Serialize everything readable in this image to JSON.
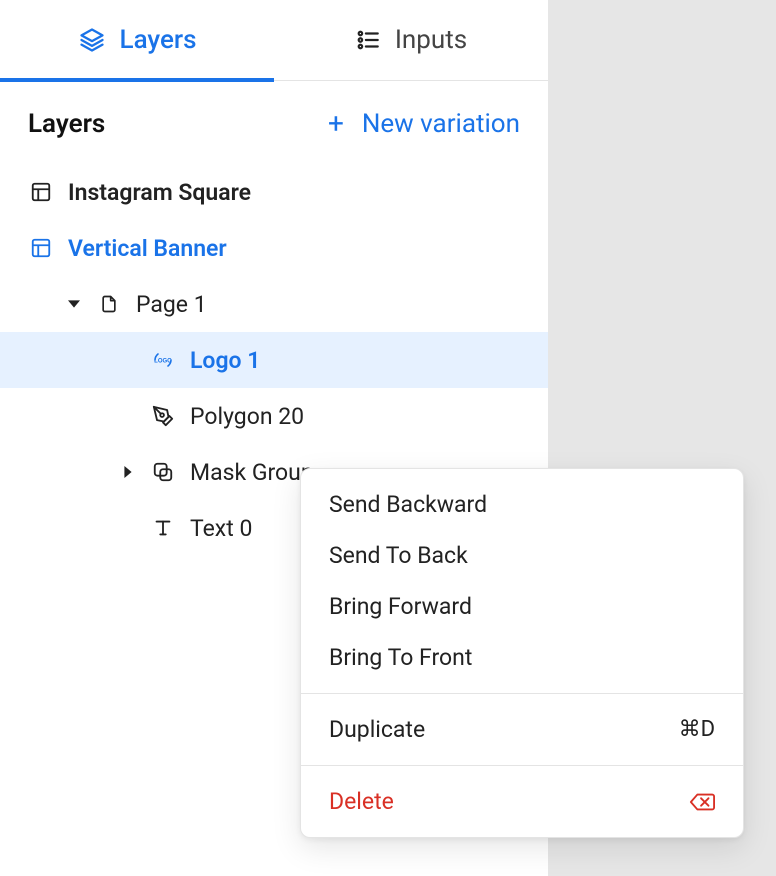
{
  "tabs": {
    "layers": "Layers",
    "inputs": "Inputs"
  },
  "section": {
    "title": "Layers",
    "new_variation": "New variation",
    "plus": "+"
  },
  "tree": {
    "artboard_instagram": "Instagram Square",
    "artboard_vertical_banner": "Vertical Banner",
    "page1": "Page 1",
    "logo1": "Logo 1",
    "polygon20": "Polygon 20",
    "mask_group": "Mask Group",
    "text0": "Text 0"
  },
  "context_menu": {
    "send_backward": "Send Backward",
    "send_to_back": "Send To Back",
    "bring_forward": "Bring Forward",
    "bring_to_front": "Bring To Front",
    "duplicate": "Duplicate",
    "duplicate_shortcut": "⌘D",
    "delete": "Delete"
  },
  "colors": {
    "accent": "#1a73e8",
    "danger": "#d93025",
    "selection_bg": "#e6f1ff"
  }
}
